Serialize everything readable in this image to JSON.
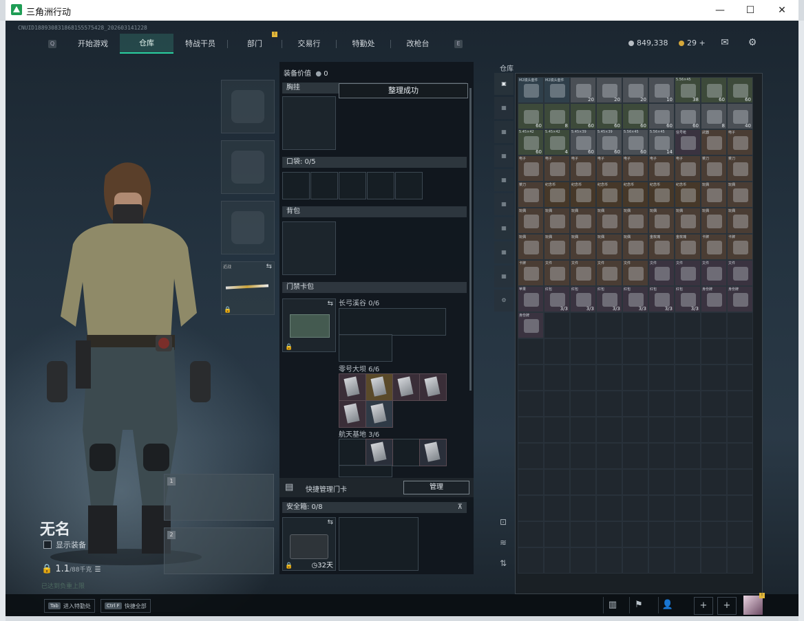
{
  "window": {
    "title": "三角洲行动",
    "min": "—",
    "max": "☐",
    "close": "✕"
  },
  "cnid": "CNUID188930831868155575428_202603141228",
  "nav": {
    "left_key": "Q",
    "right_key": "E",
    "tabs": [
      {
        "label": "开始游戏",
        "active": false
      },
      {
        "label": "仓库",
        "active": true
      },
      {
        "label": "特战干员",
        "active": false
      },
      {
        "label": "部门",
        "active": false,
        "badge": "!"
      },
      {
        "label": "交易行",
        "active": false
      },
      {
        "label": "特勤处",
        "active": false
      },
      {
        "label": "改枪台",
        "active": false
      }
    ]
  },
  "currency": {
    "silver": "849,338",
    "gold": "29",
    "add": "+"
  },
  "character": {
    "name": "无名",
    "show_equip": "显示装备",
    "weight": "1.1",
    "weight_max": "/88千克",
    "bottom_text": "已达到负重上限"
  },
  "weapon_slots": [
    {
      "num": "1"
    },
    {
      "num": "2"
    }
  ],
  "melee": {
    "label": "近战"
  },
  "equipment": {
    "value_label": "装备价值",
    "value": "0",
    "chest": "胸挂",
    "pocket": "口袋: 0/5",
    "backpack": "背包",
    "keycard": "门禁卡包",
    "keycard_sections": [
      {
        "label": "长弓溪谷 0/6"
      },
      {
        "label": "零号大坝 6/6"
      },
      {
        "label": "航天基地 3/6"
      }
    ],
    "quick_manage": "快捷管理门卡",
    "manage_btn": "管理",
    "safe_box": "安全箱: 0/8",
    "safe_days": "32天"
  },
  "toast": "整理成功",
  "stash": {
    "label": "仓库"
  },
  "stash_items": [
    {
      "label": "M2镜头套件",
      "count": "",
      "color": "#2f3f4a"
    },
    {
      "label": "M2镜头套件",
      "count": "",
      "color": "#2f3f4a"
    },
    {
      "label": "",
      "count": "20",
      "color": "#4a4f55"
    },
    {
      "label": "",
      "count": "20",
      "color": "#4a4f55"
    },
    {
      "label": "",
      "count": "20",
      "color": "#4a4f55"
    },
    {
      "label": "",
      "count": "10",
      "color": "#4a4f55"
    },
    {
      "label": "5.56×45",
      "count": "38",
      "color": "#3d4a3a"
    },
    {
      "label": "",
      "count": "60",
      "color": "#3d4a3a"
    },
    {
      "label": "",
      "count": "60",
      "color": "#3d4a3a"
    },
    {
      "label": "",
      "count": "60",
      "color": "#3d4a3a"
    },
    {
      "label": "",
      "count": "8",
      "color": "#3d4a3a"
    },
    {
      "label": "",
      "count": "60",
      "color": "#3d4a3a"
    },
    {
      "label": "",
      "count": "60",
      "color": "#3d4a3a"
    },
    {
      "label": "",
      "count": "60",
      "color": "#3d4a3a"
    },
    {
      "label": "",
      "count": "60",
      "color": "#4a4f55"
    },
    {
      "label": "",
      "count": "60",
      "color": "#4a4f55"
    },
    {
      "label": "",
      "count": "8",
      "color": "#4a4f55"
    },
    {
      "label": "",
      "count": "40",
      "color": "#4a4f55"
    },
    {
      "label": "5.45×42",
      "count": "60",
      "color": "#3d4a3a"
    },
    {
      "label": "5.45×42",
      "count": "4",
      "color": "#3d4a3a"
    },
    {
      "label": "5.45×39",
      "count": "60",
      "color": "#4a4f55"
    },
    {
      "label": "5.45×39",
      "count": "60",
      "color": "#4a4f55"
    },
    {
      "label": "5.56×45",
      "count": "60",
      "color": "#4a4f55"
    },
    {
      "label": "5.56×45",
      "count": "14",
      "color": "#4a4f55"
    },
    {
      "label": "信号枪",
      "count": "",
      "color": "#3a3340"
    },
    {
      "label": "武器",
      "count": "",
      "color": "#4a3d34"
    },
    {
      "label": "电子",
      "count": "",
      "color": "#4a3d34"
    },
    {
      "label": "电子",
      "count": "",
      "color": "#4a3d34"
    },
    {
      "label": "电子",
      "count": "",
      "color": "#4a3d34"
    },
    {
      "label": "电子",
      "count": "",
      "color": "#4a3d34"
    },
    {
      "label": "电子",
      "count": "",
      "color": "#4a3d34"
    },
    {
      "label": "电子",
      "count": "",
      "color": "#4a3d34"
    },
    {
      "label": "电子",
      "count": "",
      "color": "#4a3d34"
    },
    {
      "label": "电子",
      "count": "",
      "color": "#4a3d34"
    },
    {
      "label": "菜刀",
      "count": "",
      "color": "#4a3d34"
    },
    {
      "label": "菜刀",
      "count": "",
      "color": "#4a3d34"
    },
    {
      "label": "菜刀",
      "count": "",
      "color": "#4a3d34"
    },
    {
      "label": "纪念币",
      "count": "",
      "color": "#463829"
    },
    {
      "label": "纪念币",
      "count": "",
      "color": "#463829"
    },
    {
      "label": "纪念币",
      "count": "",
      "color": "#463829"
    },
    {
      "label": "纪念币",
      "count": "",
      "color": "#463829"
    },
    {
      "label": "纪念币",
      "count": "",
      "color": "#463829"
    },
    {
      "label": "纪念币",
      "count": "",
      "color": "#463829"
    },
    {
      "label": "玩偶",
      "count": "",
      "color": "#4a3d34"
    },
    {
      "label": "玩偶",
      "count": "",
      "color": "#4a3d34"
    },
    {
      "label": "玩偶",
      "count": "",
      "color": "#4a3d34"
    },
    {
      "label": "玩偶",
      "count": "",
      "color": "#4a3d34"
    },
    {
      "label": "玩偶",
      "count": "",
      "color": "#4a3d34"
    },
    {
      "label": "玩偶",
      "count": "",
      "color": "#4a3d34"
    },
    {
      "label": "玩偶",
      "count": "",
      "color": "#4a3d34"
    },
    {
      "label": "玩偶",
      "count": "",
      "color": "#4a3d34"
    },
    {
      "label": "玩偶",
      "count": "",
      "color": "#4a3d34"
    },
    {
      "label": "玩偶",
      "count": "",
      "color": "#4a3d34"
    },
    {
      "label": "玩偶",
      "count": "",
      "color": "#4a3d34"
    },
    {
      "label": "玩偶",
      "count": "",
      "color": "#4a3d34"
    },
    {
      "label": "玩偶",
      "count": "",
      "color": "#4a3d34"
    },
    {
      "label": "玩偶",
      "count": "",
      "color": "#4a3d34"
    },
    {
      "label": "玩偶",
      "count": "",
      "color": "#4a3d34"
    },
    {
      "label": "玩偶",
      "count": "",
      "color": "#4a3d34"
    },
    {
      "label": "金玫瑰",
      "count": "",
      "color": "#4a3d34"
    },
    {
      "label": "金玫瑰",
      "count": "",
      "color": "#4a3d34"
    },
    {
      "label": "卡牌",
      "count": "",
      "color": "#4a3d34"
    },
    {
      "label": "卡牌",
      "count": "",
      "color": "#4a3d34"
    },
    {
      "label": "卡牌",
      "count": "",
      "color": "#4a3d34"
    },
    {
      "label": "文件",
      "count": "",
      "color": "#4a3d34"
    },
    {
      "label": "文件",
      "count": "",
      "color": "#4a3d34"
    },
    {
      "label": "文件",
      "count": "",
      "color": "#4a3d34"
    },
    {
      "label": "文件",
      "count": "",
      "color": "#4a3d34"
    },
    {
      "label": "文件",
      "count": "",
      "color": "#3a3340"
    },
    {
      "label": "文件",
      "count": "",
      "color": "#3a3340"
    },
    {
      "label": "文件",
      "count": "",
      "color": "#3a3340"
    },
    {
      "label": "文件",
      "count": "",
      "color": "#3a3340"
    },
    {
      "label": "苹果",
      "count": "",
      "color": "#3a3340"
    },
    {
      "label": "红包",
      "count": "3/3",
      "color": "#3a3340"
    },
    {
      "label": "红包",
      "count": "3/3",
      "color": "#3a3340"
    },
    {
      "label": "红包",
      "count": "3/3",
      "color": "#3a3340"
    },
    {
      "label": "红包",
      "count": "3/3",
      "color": "#3a3340"
    },
    {
      "label": "红包",
      "count": "3/3",
      "color": "#3a3340"
    },
    {
      "label": "红包",
      "count": "3/3",
      "color": "#3a3340"
    },
    {
      "label": "身份牌",
      "count": "",
      "color": "#3a3340"
    },
    {
      "label": "身份牌",
      "count": "",
      "color": "#3a3340"
    },
    {
      "label": "身份牌",
      "count": "",
      "color": "#3a3340"
    }
  ],
  "bottom": {
    "hint1_key": "Tab",
    "hint1": "进入特勤处",
    "hint2_key": "Ctrl F",
    "hint2": "快捷全部",
    "avatar_badge": "!"
  },
  "icons": {
    "mail": "mail-icon",
    "settings": "gear-icon",
    "stats": "chart-icon",
    "flag": "flag-icon",
    "friends": "friends-icon",
    "lock": "lock-icon",
    "swap": "swap-icon",
    "clock": "clock-icon",
    "pin": "pin-icon"
  }
}
